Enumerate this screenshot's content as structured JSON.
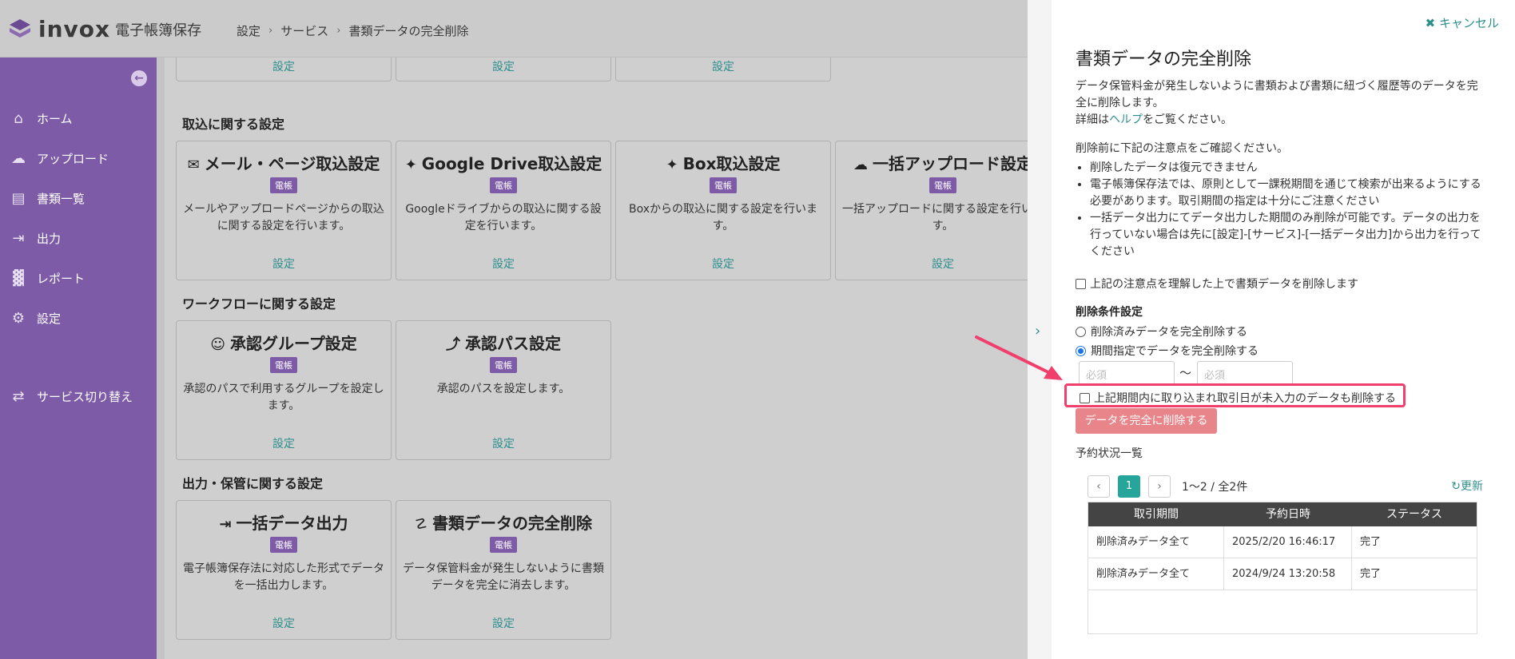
{
  "app": {
    "brand": "invox",
    "product": "電子帳簿保存"
  },
  "breadcrumb": [
    "設定",
    "サービス",
    "書類データの完全削除"
  ],
  "sidebar": {
    "items": [
      {
        "icon": "home-icon",
        "label": "ホーム"
      },
      {
        "icon": "cloud-upload-icon",
        "label": "アップロード"
      },
      {
        "icon": "document-icon",
        "label": "書類一覧"
      },
      {
        "icon": "export-icon",
        "label": "出力"
      },
      {
        "icon": "chart-icon",
        "label": "レポート"
      },
      {
        "icon": "gear-icon",
        "label": "設定"
      },
      {
        "icon": "switch-service-icon",
        "label": "サービス切り替え"
      }
    ]
  },
  "main": {
    "top_links": [
      "設定",
      "設定",
      "設定"
    ],
    "sections": [
      {
        "title": "取込に関する設定",
        "cards": [
          {
            "title": "メール・ページ取込設定",
            "badge": "電帳",
            "desc": "メールやアップロードページからの取込に関する設定を行います。",
            "link": "設定"
          },
          {
            "title": "Google Drive取込設定",
            "badge": "電帳",
            "desc": "Googleドライブからの取込に関する設定を行います。",
            "link": "設定"
          },
          {
            "title": "Box取込設定",
            "badge": "電帳",
            "desc": "Boxからの取込に関する設定を行います。",
            "link": "設定"
          },
          {
            "title": "一括アップロード設定",
            "badge": "電帳",
            "desc": "一括アップロードに関する設定を行います。",
            "link": "設定"
          }
        ]
      },
      {
        "title": "ワークフローに関する設定",
        "cards": [
          {
            "title": "承認グループ設定",
            "badge": "電帳",
            "desc": "承認のパスで利用するグループを設定します。",
            "link": "設定"
          },
          {
            "title": "承認パス設定",
            "badge": "電帳",
            "desc": "承認のパスを設定します。",
            "link": "設定"
          }
        ]
      },
      {
        "title": "出力・保管に関する設定",
        "cards": [
          {
            "title": "一括データ出力",
            "badge": "電帳",
            "desc": "電子帳簿保存法に対応した形式でデータを一括出力します。",
            "link": "設定"
          },
          {
            "title": "書類データの完全削除",
            "badge": "電帳",
            "desc": "データ保管料金が発生しないように書類データを完全に消去します。",
            "link": "設定"
          }
        ]
      }
    ]
  },
  "panel": {
    "cancel_label": "キャンセル",
    "title": "書類データの完全削除",
    "intro_line1": "データ保管料金が発生しないように書類および書類に紐づく履歴等のデータを完",
    "intro_line2": "全に削除します。",
    "help_prefix": "詳細は",
    "help_link": "ヘルプ",
    "help_suffix": "をご覧ください。",
    "notice_heading": "削除前に下記の注意点をご確認ください。",
    "notices": [
      "削除したデータは復元できません",
      "電子帳簿保存法では、原則として一課税期間を通じて検索が出来るようにする必要があります。取引期間の指定は十分にご注意ください",
      "一括データ出力にてデータ出力した期間のみ削除が可能です。データの出力を行っていない場合は先に[設定]-[サービス]-[一括データ出力]から出力を行ってください"
    ],
    "confirm_label": "上記の注意点を理解した上で書類データを削除します",
    "condition_heading": "削除条件設定",
    "radio_deleted": "削除済みデータを完全削除する",
    "radio_period": "期間指定でデータを完全削除する",
    "date_from_placeholder": "必須",
    "date_to_placeholder": "必須",
    "tilde": "〜",
    "include_untyped_label": "上記期間内に取り込まれ取引日が未入力のデータも削除する",
    "delete_button": "データを完全に削除する",
    "reservations_heading": "予約状況一覧",
    "pager": {
      "current": "1",
      "info": "1〜2 / 全2件"
    },
    "refresh_label": "更新",
    "table": {
      "headers": [
        "取引期間",
        "予約日時",
        "ステータス"
      ],
      "rows": [
        [
          "削除済みデータ全て",
          "2025/2/20 16:46:17",
          "完了"
        ],
        [
          "削除済みデータ全て",
          "2024/9/24 13:20:58",
          "完了"
        ]
      ]
    }
  },
  "colors": {
    "sidebar": "#7e5ba6",
    "accent": "#2d8f8c",
    "danger_button": "#e7858a",
    "highlight": "#ef3f6a"
  }
}
